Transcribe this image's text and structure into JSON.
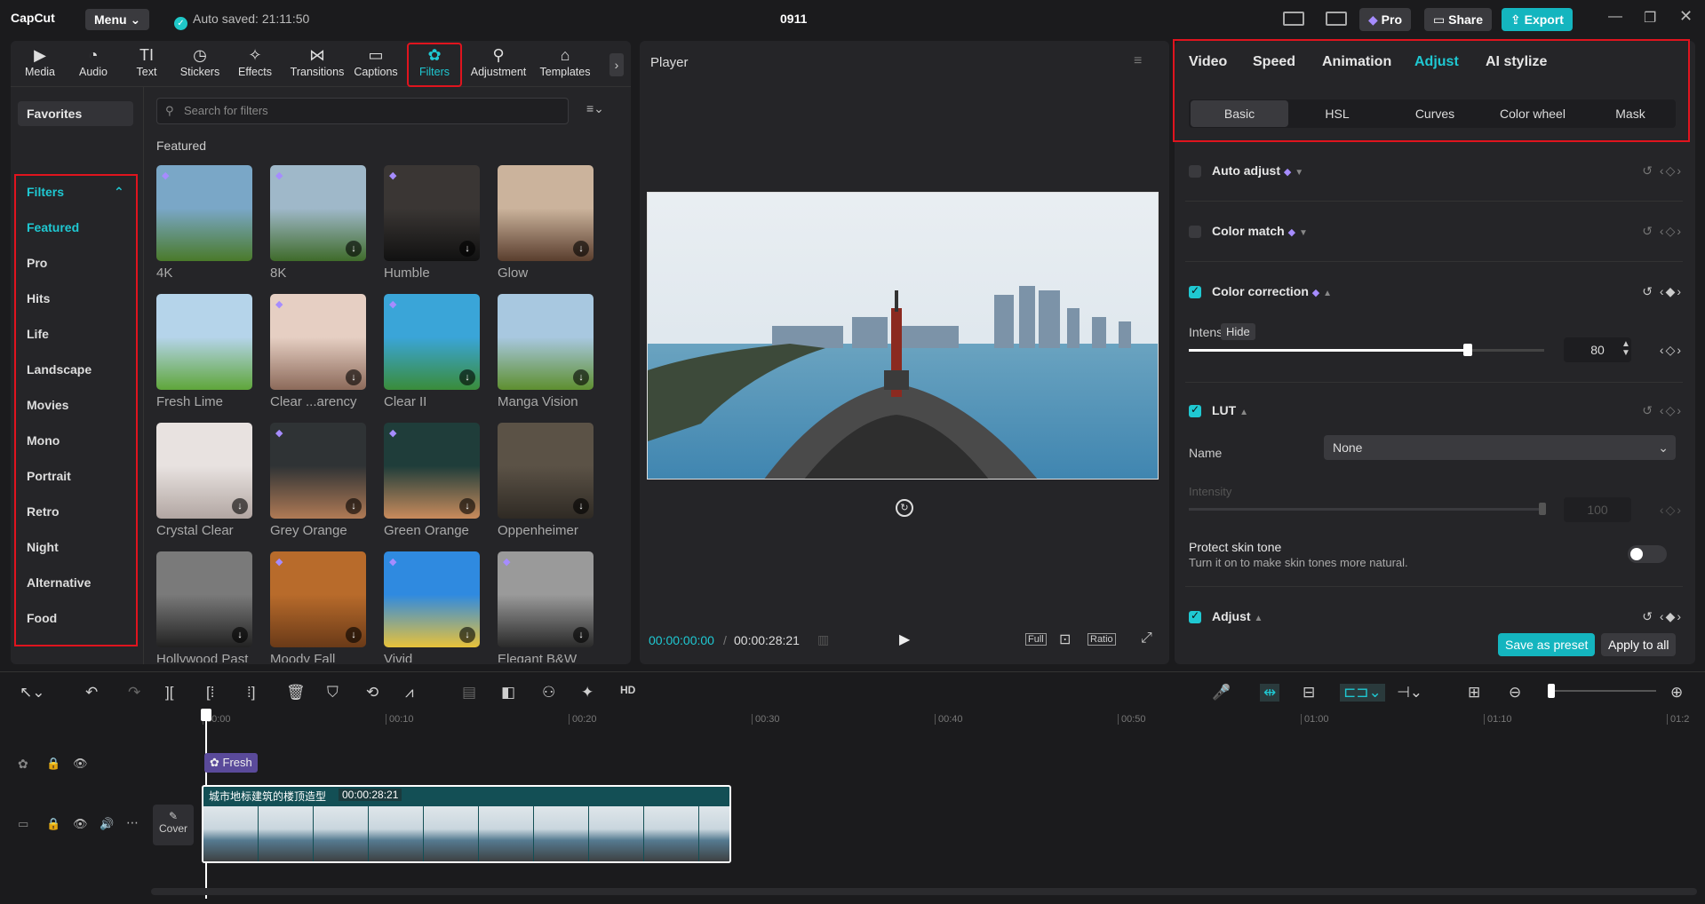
{
  "app": {
    "logo": "CapCut",
    "menu": "Menu",
    "autosave": "Auto saved: 21:11:50",
    "project": "0911",
    "pro": "Pro",
    "share": "Share",
    "export": "Export"
  },
  "tools": [
    {
      "label": "Media",
      "icon": "media-icon"
    },
    {
      "label": "Audio",
      "icon": "audio-icon"
    },
    {
      "label": "Text",
      "icon": "text-icon"
    },
    {
      "label": "Stickers",
      "icon": "stickers-icon"
    },
    {
      "label": "Effects",
      "icon": "effects-icon"
    },
    {
      "label": "Transitions",
      "icon": "transitions-icon"
    },
    {
      "label": "Captions",
      "icon": "captions-icon"
    },
    {
      "label": "Filters",
      "icon": "filters-icon"
    },
    {
      "label": "Adjustment",
      "icon": "adjustment-icon"
    },
    {
      "label": "Templates",
      "icon": "templates-icon"
    }
  ],
  "sidebar": {
    "favorites": "Favorites",
    "filters": "Filters",
    "categories": [
      "Featured",
      "Pro",
      "Hits",
      "Life",
      "Landscape",
      "Movies",
      "Mono",
      "Portrait",
      "Retro",
      "Night",
      "Alternative",
      "Food"
    ]
  },
  "search": {
    "placeholder": "Search for filters"
  },
  "section": "Featured",
  "filters": [
    {
      "name": "4K",
      "c1": "#7aa7c7",
      "c2": "#4a7a2a"
    },
    {
      "name": "8K",
      "c1": "#9fb8c9",
      "c2": "#3f6b2a"
    },
    {
      "name": "Humble",
      "c1": "#3a3634",
      "c2": "#111"
    },
    {
      "name": "Glow",
      "c1": "#cbb39c",
      "c2": "#5a3e2e"
    },
    {
      "name": "Fresh Lime",
      "c1": "#b5d4ea",
      "c2": "#5fa63a"
    },
    {
      "name": "Clear ...arency",
      "c1": "#e6cfc3",
      "c2": "#8c6a5a"
    },
    {
      "name": "Clear II",
      "c1": "#3aa5d8",
      "c2": "#3a8c3a"
    },
    {
      "name": "Manga Vision",
      "c1": "#a8c8e0",
      "c2": "#5e8f2f"
    },
    {
      "name": "Crystal Clear",
      "c1": "#e8e2e0",
      "c2": "#b2a6a2"
    },
    {
      "name": "Grey Orange",
      "c1": "#2f3335",
      "c2": "#b07a55"
    },
    {
      "name": "Green Orange",
      "c1": "#1f3d3a",
      "c2": "#c98b5c"
    },
    {
      "name": "Oppenheimer",
      "c1": "#5b5246",
      "c2": "#2f2a24"
    },
    {
      "name": "Hollywood Past",
      "c1": "#7a7a7a",
      "c2": "#222"
    },
    {
      "name": "Moody Fall",
      "c1": "#b86b2b",
      "c2": "#6a3a18"
    },
    {
      "name": "Vivid",
      "c1": "#2f8ae0",
      "c2": "#e8c23a"
    },
    {
      "name": "Elegant B&W",
      "c1": "#9a9a9a",
      "c2": "#2a2a2a"
    }
  ],
  "player": {
    "title": "Player",
    "time_current": "00:00:00:00",
    "time_total": "00:00:28:21",
    "full": "Full",
    "ratio": "Ratio"
  },
  "right": {
    "tabs": [
      "Video",
      "Speed",
      "Animation",
      "Adjust",
      "AI stylize"
    ],
    "subtabs": [
      "Basic",
      "HSL",
      "Curves",
      "Color wheel",
      "Mask"
    ],
    "auto_adjust": "Auto adjust",
    "color_match": "Color match",
    "color_correction": "Color correction",
    "intensity_label": "Intens",
    "tooltip": "Hide",
    "intensity_value": "80",
    "lut": "LUT",
    "name_label": "Name",
    "name_value": "None",
    "lut_intensity": "Intensity",
    "lut_intensity_value": "100",
    "protect": "Protect skin tone",
    "protect_desc": "Turn it on to make skin tones more natural.",
    "adjust": "Adjust",
    "save_preset": "Save as preset",
    "apply_all": "Apply to all"
  },
  "timeline": {
    "ruler": [
      "00:00",
      "00:10",
      "00:20",
      "00:30",
      "00:40",
      "00:50",
      "01:00",
      "01:10",
      "01:2"
    ],
    "filter_clip": "Fresh",
    "video_clip_name": "城市地标建筑的楼顶造型",
    "video_clip_duration": "00:00:28:21",
    "cover": "Cover"
  },
  "colors": {
    "accent": "#1fc8d2",
    "highlight": "#e0141e"
  }
}
